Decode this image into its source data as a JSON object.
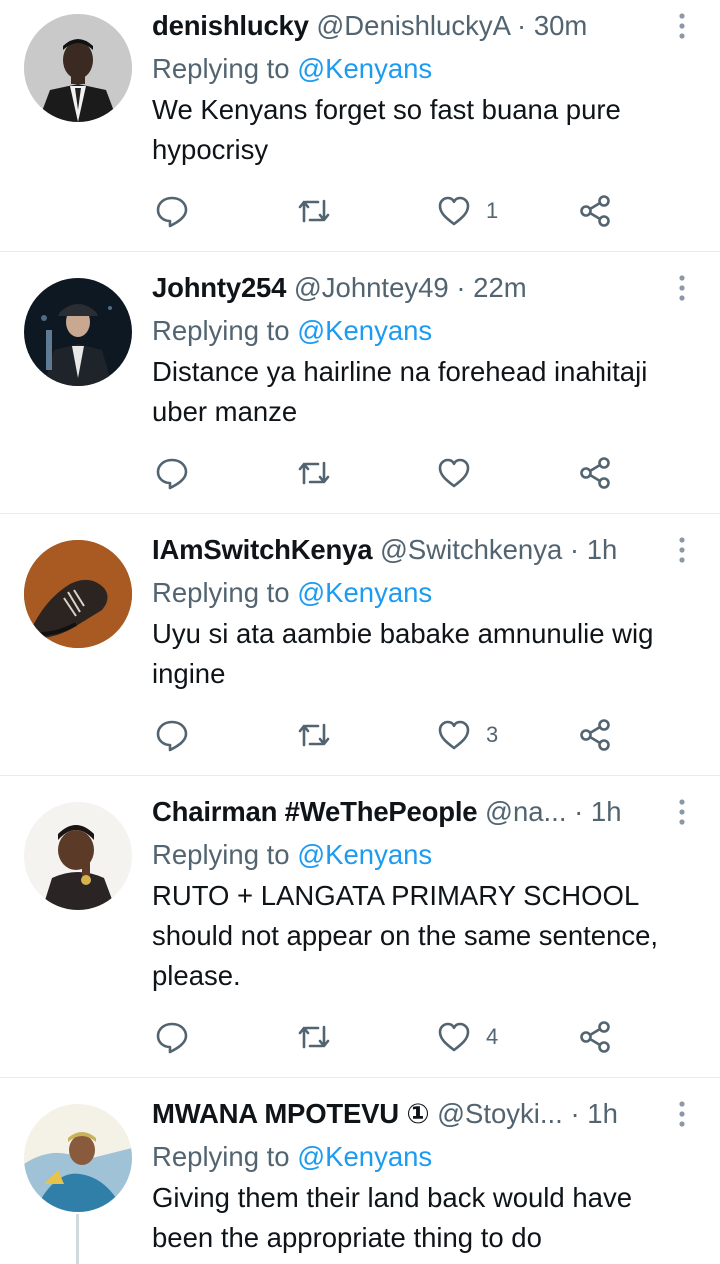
{
  "colors": {
    "link": "#1d9bf0",
    "secondary_text": "#536471",
    "primary_text": "#0f1419",
    "divider": "#e6ecf0"
  },
  "icons": {
    "reply": "reply-bubble-icon",
    "retweet": "retweet-arrows-icon",
    "like": "heart-icon",
    "share": "share-nodes-icon",
    "more": "vertical-dots-more-icon"
  },
  "tweets": [
    {
      "name": "denishlucky",
      "handle": "@DenishluckyA",
      "dot": "·",
      "time": "30m",
      "replying_prefix": "Replying to",
      "replying_to": "@Kenyans",
      "text": "We Kenyans forget so fast buana pure hypocrisy",
      "like_count": "1"
    },
    {
      "name": "Johnty254",
      "handle": "@Johntey49",
      "dot": "·",
      "time": "22m",
      "replying_prefix": "Replying to",
      "replying_to": "@Kenyans",
      "text": "Distance ya hairline na forehead inahitaji uber manze",
      "like_count": ""
    },
    {
      "name": "IAmSwitchKenya",
      "handle": "@Switchkenya",
      "dot": "·",
      "time": "1h",
      "replying_prefix": "Replying to",
      "replying_to": "@Kenyans",
      "text": "Uyu si ata aambie babake amnunulie wig ingine",
      "like_count": "3"
    },
    {
      "name": "Chairman #WeThePeople",
      "handle": "@na...",
      "dot": "·",
      "time": "1h",
      "replying_prefix": "Replying to",
      "replying_to": "@Kenyans",
      "text": "RUTO + LANGATA PRIMARY SCHOOL should not appear on the same sentence, please.",
      "like_count": "4"
    },
    {
      "name": "MWANA MPOTEVU ①",
      "handle": "@Stoyki...",
      "dot": "·",
      "time": "1h",
      "replying_prefix": "Replying to",
      "replying_to": "@Kenyans",
      "text": "Giving them their land back would have been the appropriate thing to do",
      "like_count": ""
    }
  ]
}
